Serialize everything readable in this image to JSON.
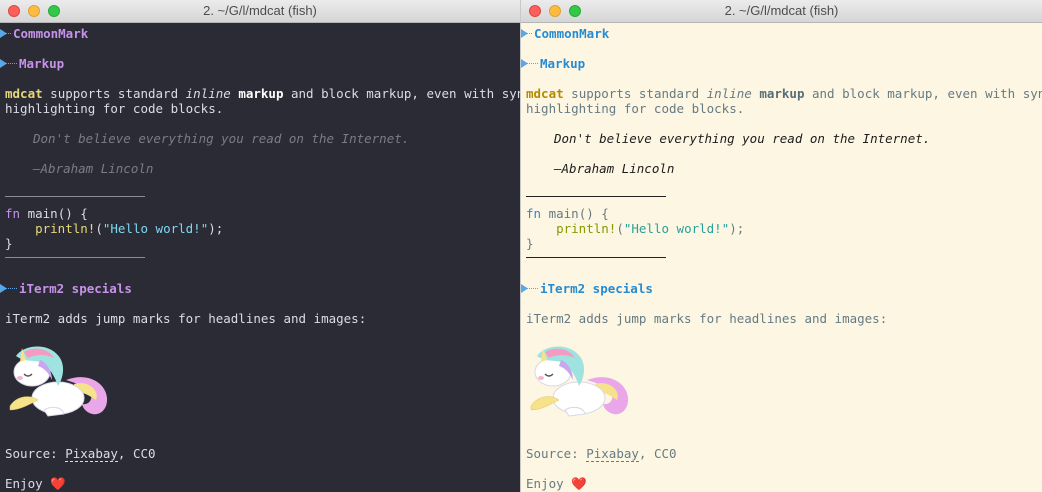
{
  "window_title": "2. ~/G/l/mdcat (fish)",
  "headings": {
    "h1": "CommonMark",
    "h2": "Markup",
    "h3": "iTerm2 specials"
  },
  "para1": {
    "mdcat": "mdcat",
    "t1": " supports standard ",
    "inline": "inline",
    "t2": " ",
    "markup": "markup",
    "t3": " and block markup, even with syntax",
    "line2": "highlighting for code blocks."
  },
  "quote": {
    "text": "Don't believe everything you read on the Internet.",
    "author": "—Abraham Lincoln"
  },
  "code": {
    "kw": "fn",
    "fn_rest": " main() {",
    "indent": "    ",
    "macro": "println!",
    "open": "(",
    "str": "\"Hello world!\"",
    "close": ");",
    "end": "}"
  },
  "iterm_text": "iTerm2 adds jump marks for headlines and images:",
  "source": {
    "label": "Source: ",
    "link": "Pixabay",
    "rest": ", CC0"
  },
  "enjoy": {
    "text": "Enjoy ",
    "heart": "❤️"
  },
  "colors": {
    "dark_bg": "#2b2b35",
    "light_bg": "#fdf6e3",
    "dark_heading": "#c792ea",
    "light_heading": "#268bd2"
  },
  "icons": {
    "jump_mark": "jump-mark-arrow-icon",
    "image": "unicorn-image"
  }
}
